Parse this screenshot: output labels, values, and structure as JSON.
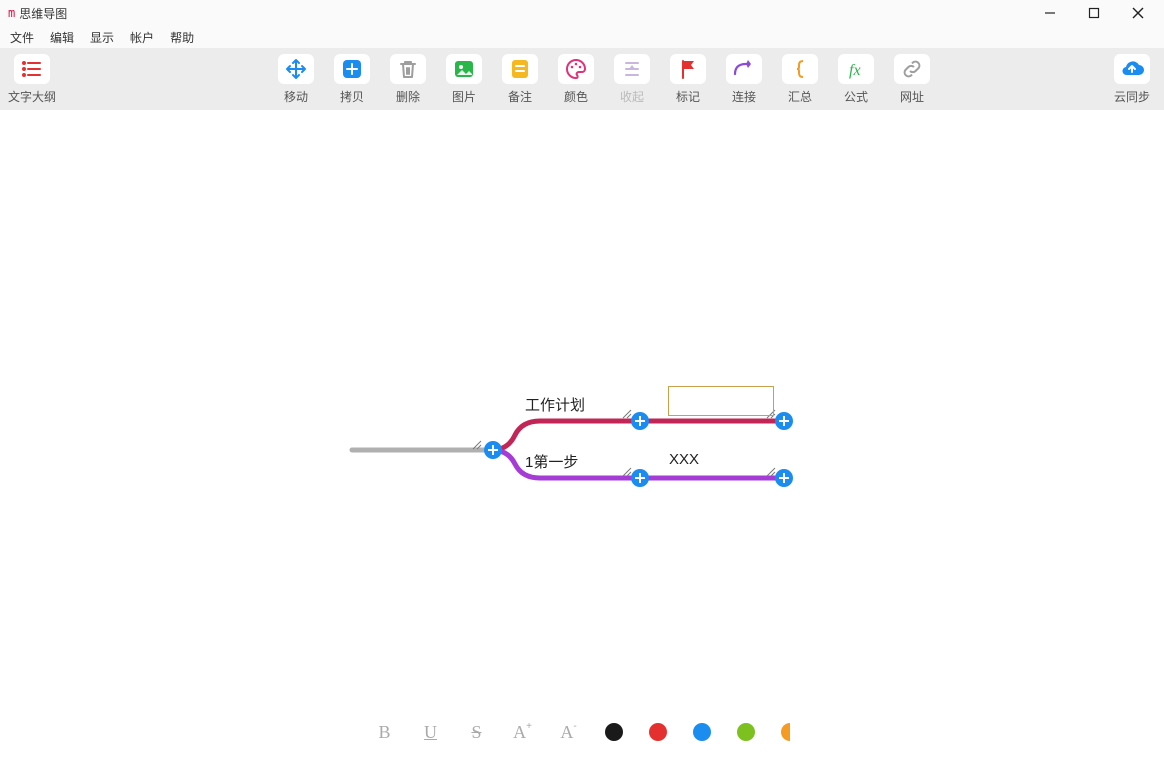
{
  "window": {
    "title": "思维导图"
  },
  "menu": {
    "file": "文件",
    "edit": "编辑",
    "view": "显示",
    "account": "帐户",
    "help": "帮助"
  },
  "toolbar": {
    "outline": "文字大纲",
    "move": "移动",
    "copy": "拷贝",
    "delete": "删除",
    "image": "图片",
    "note": "备注",
    "color": "颜色",
    "collapse": "收起",
    "mark": "标记",
    "connect": "连接",
    "summary": "汇总",
    "formula": "公式",
    "url": "网址",
    "cloud": "云同步"
  },
  "mindmap": {
    "root": "",
    "branches": [
      {
        "label": "工作计划",
        "child": ""
      },
      {
        "label": "1第一步",
        "child": "XXX"
      }
    ]
  },
  "bottom": {
    "formats": [
      {
        "name": "bold",
        "glyph": "B"
      },
      {
        "name": "underline",
        "glyph": "U"
      },
      {
        "name": "strike",
        "glyph": "S"
      },
      {
        "name": "increase-font",
        "glyph": "A+"
      },
      {
        "name": "decrease-font",
        "glyph": "A-"
      }
    ],
    "colors": [
      {
        "name": "black",
        "hex": "#1a1a1a"
      },
      {
        "name": "red",
        "hex": "#e53030"
      },
      {
        "name": "blue",
        "hex": "#1b8cf0"
      },
      {
        "name": "green",
        "hex": "#7cc11f"
      },
      {
        "name": "orange",
        "hex": "#f59a22"
      }
    ]
  },
  "colors": {
    "branch_top": "#c12656",
    "branch_bottom": "#a63cd6",
    "root_stem": "#b0b0b0",
    "selection_border": "#caa04d",
    "add_handle": "#1b8cf0"
  }
}
